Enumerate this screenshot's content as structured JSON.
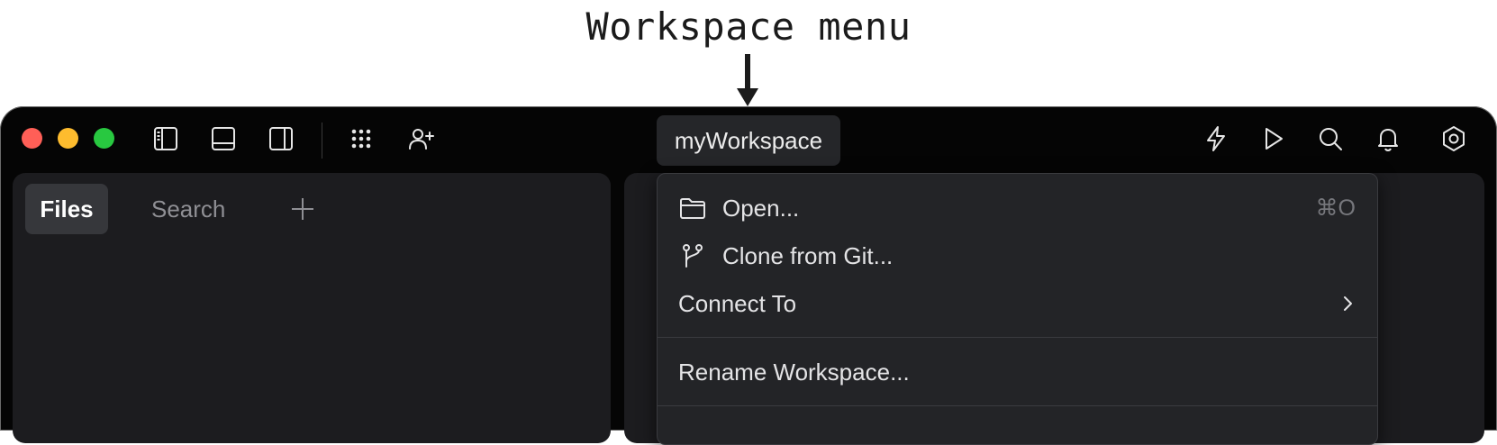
{
  "caption": "Workspace menu",
  "workspace": {
    "name": "myWorkspace"
  },
  "left_panel": {
    "tabs": [
      {
        "label": "Files",
        "active": true
      },
      {
        "label": "Search",
        "active": false
      }
    ]
  },
  "toolbar_left_icons": [
    "sidebar-left-icon",
    "panel-bottom-icon",
    "sidebar-right-icon",
    "apps-grid-icon",
    "add-user-icon"
  ],
  "toolbar_right_icons": [
    "lightning-icon",
    "play-icon",
    "search-icon",
    "bell-icon",
    "settings-hexagon-icon"
  ],
  "menu": {
    "items": [
      {
        "label": "Open...",
        "icon": "folder-icon",
        "shortcut": "⌘O"
      },
      {
        "label": "Clone from Git...",
        "icon": "git-branch-icon"
      },
      {
        "label": "Connect To",
        "submenu": true
      },
      {
        "label": "Rename Workspace..."
      }
    ]
  },
  "colors": {
    "window_bg": "#050505",
    "panel_bg": "#1c1c1f",
    "menu_bg": "#232427",
    "traffic_red": "#ff5f57",
    "traffic_yellow": "#febc2e",
    "traffic_green": "#28c840"
  }
}
